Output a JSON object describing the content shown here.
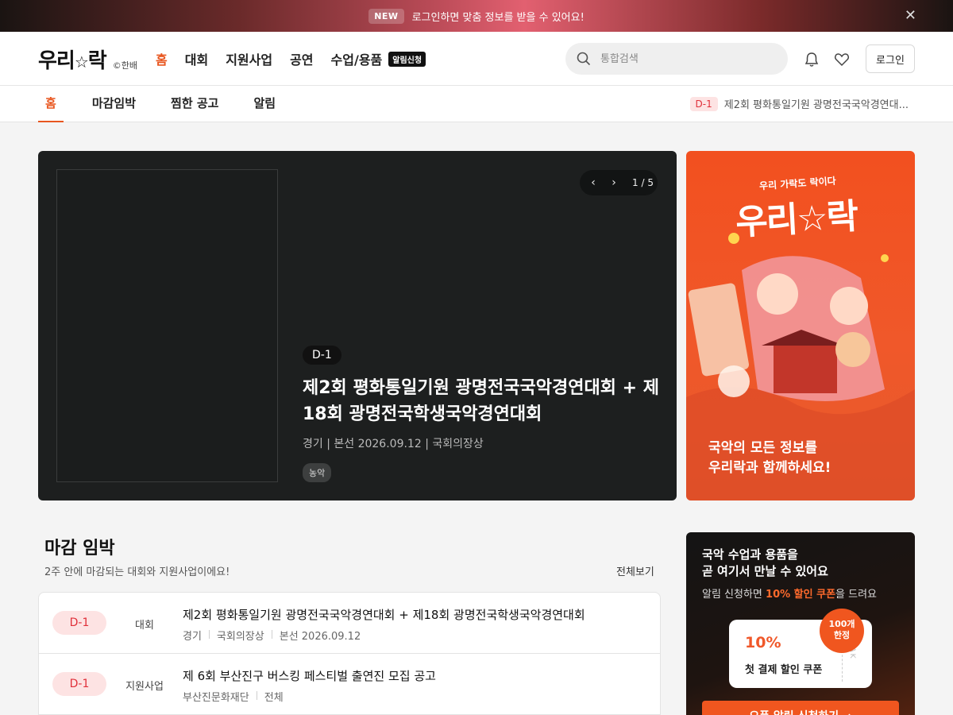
{
  "promo_bar": {
    "badge": "NEW",
    "text": "로그인하면 맞춤 정보를 받을 수 있어요!",
    "close_icon": "close-icon"
  },
  "header": {
    "logo_text": "우리",
    "logo_star": "☆",
    "logo_text2": "락",
    "logo_sub": "©한배",
    "nav": [
      {
        "label": "홈",
        "active": true
      },
      {
        "label": "대회",
        "active": false
      },
      {
        "label": "지원사업",
        "active": false
      },
      {
        "label": "공연",
        "active": false
      },
      {
        "label": "수업/용품",
        "active": false
      }
    ],
    "nav_badge": "알림신청",
    "search_placeholder": "통합검색",
    "login_label": "로그인",
    "icons": [
      "search-icon",
      "bell-icon",
      "heart-icon"
    ]
  },
  "subnav": {
    "tabs": [
      {
        "label": "홈",
        "active": true
      },
      {
        "label": "마감임박",
        "active": false
      },
      {
        "label": "찜한 공고",
        "active": false
      },
      {
        "label": "알림",
        "active": false
      }
    ],
    "ticker_badge": "D-1",
    "ticker_text": "제2회 평화통일기원 광명전국국악경연대..."
  },
  "hero": {
    "pager_current": "1",
    "pager_sep": " / ",
    "pager_total": "5",
    "dday": "D-1",
    "title": "제2회 평화통일기원 광명전국국악경연대회 + 제18회 광명전국학생국악경연대회",
    "meta": "경기 | 본선 2026.09.12 | 국회의장상",
    "tag": "농악"
  },
  "promo_card": {
    "slogan": "우리 가락도 락이다",
    "logo": "우리☆락",
    "caption_line1": "국악의 모든 정보를",
    "caption_line2": "우리락과 함께하세요!",
    "colors": {
      "primary": "#f0561f"
    }
  },
  "deadline": {
    "title": "마감 임박",
    "subtitle": "2주 안에 마감되는 대회와 지원사업이에요!",
    "see_all": "전체보기",
    "items": [
      {
        "dday": "D-1",
        "category": "대회",
        "title": "제2회 평화통일기원 광명전국국악경연대회 + 제18회 광명전국학생국악경연대회",
        "meta": [
          "경기",
          "국회의장상",
          "본선 2026.09.12"
        ]
      },
      {
        "dday": "D-1",
        "category": "지원사업",
        "title": "제 6회 부산진구 버스킹 페스티벌 출연진 모집 공고",
        "meta": [
          "부산진문화재단",
          "전체"
        ]
      }
    ]
  },
  "coupon_card": {
    "headline_line1": "국악 수업과 용품을",
    "headline_line2": "곧 여기서 만날 수 있어요",
    "desc_pre": "알림 신청하면 ",
    "desc_highlight": "10% 할인 쿠폰",
    "desc_post": "을 드려요",
    "ticket_pct": "10%",
    "ticket_name": "첫 결제 할인 쿠폰",
    "ticket_vertical": "URAK",
    "seal_line1": "100개",
    "seal_line2": "한정",
    "cta_label": "오픈 알림 신청하기 →"
  }
}
